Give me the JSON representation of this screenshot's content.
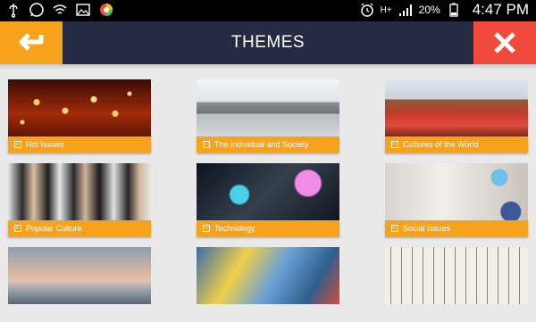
{
  "status_bar": {
    "time": "4:47 PM",
    "battery": "20%",
    "network": "H+"
  },
  "header": {
    "title": "THEMES",
    "back_icon": "back-arrow-icon",
    "close_icon": "close-icon",
    "colors": {
      "bar": "#252b42",
      "back": "#f7a21b",
      "close": "#ef4a3c"
    }
  },
  "themes": [
    {
      "label": "Hot Issues"
    },
    {
      "label": "The Individual and Society"
    },
    {
      "label": "Cultures of the World"
    },
    {
      "label": "Popular Culture"
    },
    {
      "label": "Technology"
    },
    {
      "label": "Social Issues"
    },
    {
      "label": ""
    },
    {
      "label": ""
    },
    {
      "label": ""
    }
  ],
  "accent_color": "#f7a21b"
}
